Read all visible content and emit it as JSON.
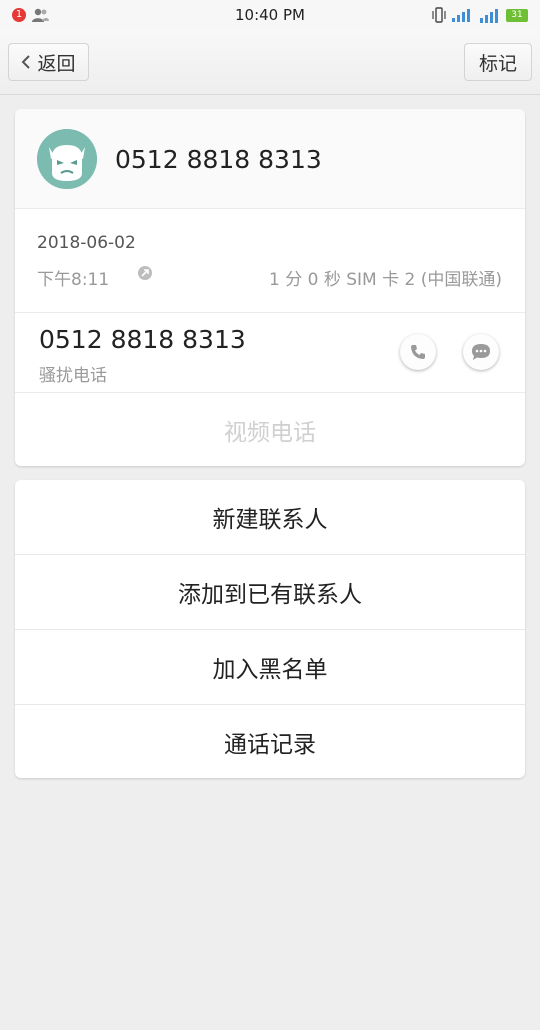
{
  "status_bar": {
    "notification_count": "1",
    "time": "10:40 PM",
    "battery": "31"
  },
  "title_bar": {
    "back_label": "返回",
    "mark_label": "标记"
  },
  "contact": {
    "number": "0512 8818 8313"
  },
  "call_info": {
    "date": "2018-06-02",
    "time": "下午8:11",
    "meta": "1 分 0 秒 SIM 卡 2 (中国联通)"
  },
  "number_row": {
    "number": "0512 8818 8313",
    "tag": "骚扰电话"
  },
  "video_call_label": "视频电话",
  "actions": [
    {
      "label": "新建联系人"
    },
    {
      "label": "添加到已有联系人"
    },
    {
      "label": "加入黑名单"
    },
    {
      "label": "通话记录"
    }
  ],
  "colors": {
    "avatar_bg": "#7bbbb0",
    "badge": "#e53935",
    "battery": "#6fbf35",
    "signal": "#3f8fd6"
  }
}
